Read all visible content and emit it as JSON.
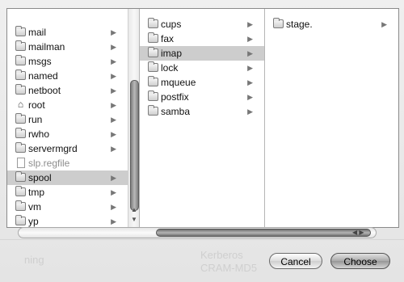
{
  "background_text": {
    "ghost_left": "ning",
    "ghost_kerberos": "Kerberos",
    "ghost_crammd5": "CRAM-MD5"
  },
  "columns": [
    {
      "items": [
        {
          "label": "mail",
          "kind": "folder",
          "has_children": true
        },
        {
          "label": "mailman",
          "kind": "folder",
          "has_children": true
        },
        {
          "label": "msgs",
          "kind": "folder",
          "has_children": true
        },
        {
          "label": "named",
          "kind": "folder",
          "has_children": true
        },
        {
          "label": "netboot",
          "kind": "folder",
          "has_children": true
        },
        {
          "label": "root",
          "kind": "home-folder",
          "has_children": true
        },
        {
          "label": "run",
          "kind": "folder",
          "has_children": true
        },
        {
          "label": "rwho",
          "kind": "folder",
          "has_children": true
        },
        {
          "label": "servermgrd",
          "kind": "folder",
          "has_children": true
        },
        {
          "label": "slp.regfile",
          "kind": "file",
          "has_children": false,
          "dimmed": true
        },
        {
          "label": "spool",
          "kind": "folder",
          "has_children": true,
          "selected": true
        },
        {
          "label": "tmp",
          "kind": "folder",
          "has_children": true
        },
        {
          "label": "vm",
          "kind": "folder",
          "has_children": true
        },
        {
          "label": "yp",
          "kind": "folder",
          "has_children": true
        }
      ]
    },
    {
      "items": [
        {
          "label": "cups",
          "kind": "folder",
          "has_children": true
        },
        {
          "label": "fax",
          "kind": "folder",
          "has_children": true
        },
        {
          "label": "imap",
          "kind": "folder",
          "has_children": true,
          "selected": true
        },
        {
          "label": "lock",
          "kind": "folder",
          "has_children": true
        },
        {
          "label": "mqueue",
          "kind": "folder",
          "has_children": true
        },
        {
          "label": "postfix",
          "kind": "folder",
          "has_children": true
        },
        {
          "label": "samba",
          "kind": "folder",
          "has_children": true
        }
      ]
    },
    {
      "items": [
        {
          "label": "stage.",
          "kind": "folder",
          "has_children": true
        }
      ]
    }
  ],
  "icons": {
    "folder": "folder-icon",
    "home": "home-folder-icon",
    "file": "document-icon",
    "arrow": "chevron-right-icon"
  },
  "buttons": {
    "cancel": "Cancel",
    "choose": "Choose"
  },
  "colors": {
    "selection": "#cdcdcd",
    "accent": "#979797"
  }
}
